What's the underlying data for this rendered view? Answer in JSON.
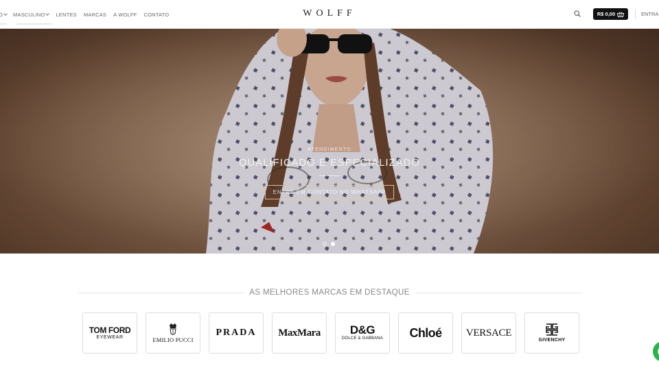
{
  "header": {
    "nav": [
      {
        "label": "O",
        "has_dropdown": true
      },
      {
        "label": "MASCULINO",
        "has_dropdown": true
      },
      {
        "label": "LENTES",
        "has_dropdown": false
      },
      {
        "label": "MARCAS",
        "has_dropdown": false
      },
      {
        "label": "A WOLFF",
        "has_dropdown": false
      },
      {
        "label": "CONTATO",
        "has_dropdown": false
      }
    ],
    "logo": "WOLFF",
    "search_icon": "search-icon",
    "cart": {
      "amount": "R$ 0,00",
      "icon": "basket-icon"
    },
    "login": "ENTRA"
  },
  "hero": {
    "eyebrow": "ATENDIMENTO",
    "title": "QUALIFICADO E ESPECIALIZADO",
    "button": "ENTRE EM CONTATO NO WHATSAPP",
    "slides_total": 2,
    "active_slide": 2
  },
  "brands": {
    "title": "AS MELHORES MARCAS EM DESTAQUE",
    "items": [
      {
        "name": "TOM FORD",
        "sub": "EYEWEAR"
      },
      {
        "name": "EMILIO PUCCI"
      },
      {
        "name": "PRADA"
      },
      {
        "name": "MaxMara"
      },
      {
        "name": "D&G",
        "sub": "DOLCE & GABBANA"
      },
      {
        "name": "Chloé"
      },
      {
        "name": "VERSACE"
      },
      {
        "name": "GIVENCHY"
      }
    ]
  },
  "chat": {
    "icon": "whatsapp-icon"
  },
  "colors": {
    "accent_button": "#111111",
    "hero_button_border": "#e6c8a0",
    "chat": "#2bb24c"
  }
}
